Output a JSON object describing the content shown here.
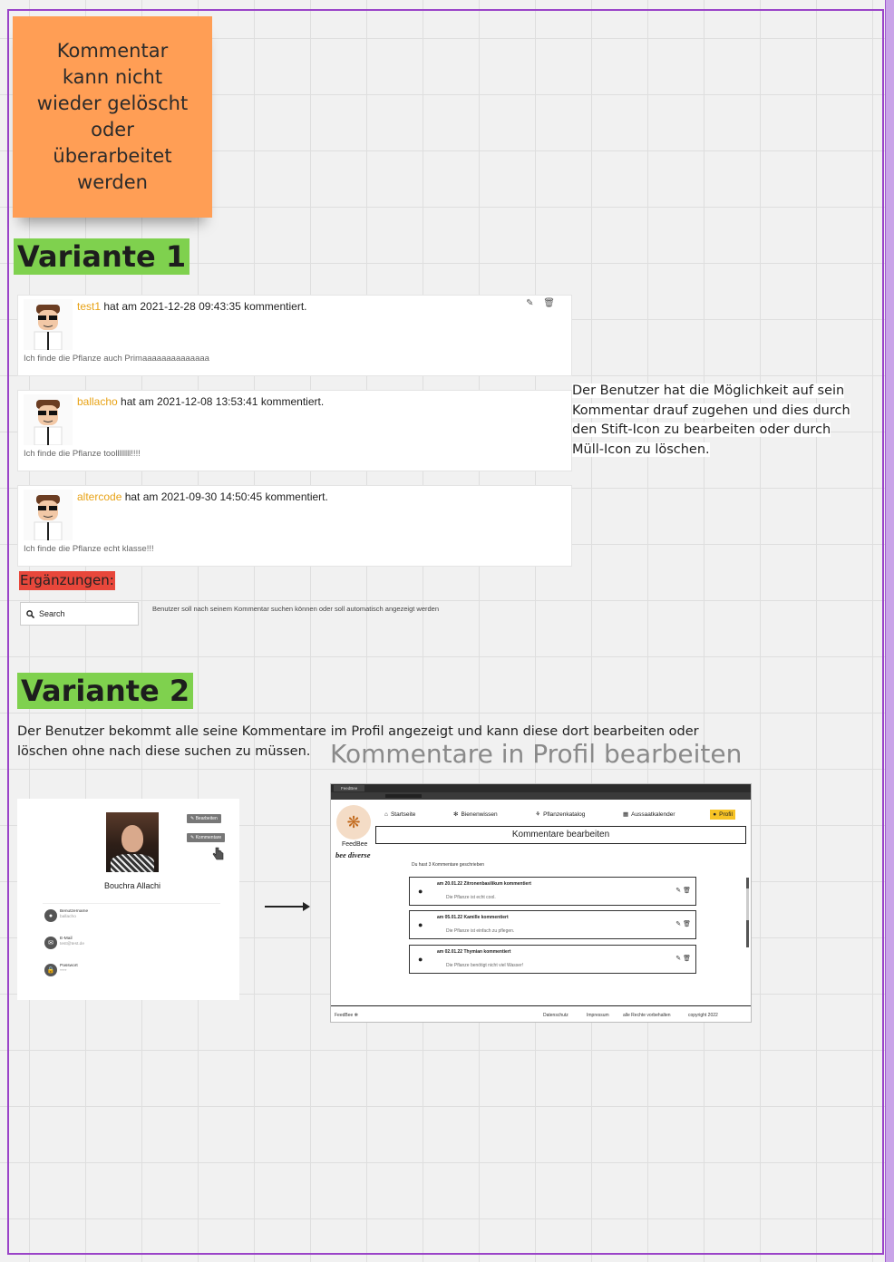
{
  "sticky_note": "Kommentar kann nicht wieder gelöscht oder überarbeitet werden",
  "variant1": {
    "title": "Variante 1",
    "comments": [
      {
        "user": "test1",
        "text": " hat am 2021-12-28 09:43:35 kommentiert.",
        "body": "Ich finde die Pflanze auch Primaaaaaaaaaaaaaa",
        "actions": "✎ 🗑"
      },
      {
        "user": "ballacho",
        "text": " hat am 2021-12-08 13:53:41 kommentiert.",
        "body": "Ich finde die Pflanze toollllllll!!!!"
      },
      {
        "user": "altercode",
        "text": " hat am 2021-09-30 14:50:45 kommentiert.",
        "body": "Ich finde die Pflanze echt klasse!!!"
      }
    ],
    "description": "Der Benutzer hat die Möglichkeit auf sein Kommentar drauf zugehen und dies durch den Stift-Icon zu bearbeiten oder durch Müll-Icon zu löschen.",
    "additions_label": "Ergänzungen:",
    "search_placeholder": "Search",
    "search_note": "Benutzer soll nach seinem Kommentar suchen können oder soll automatisch angezeigt werden"
  },
  "variant2": {
    "title": "Variante 2",
    "description": "Der Benutzer bekommt alle seine Kommentare im Profil angezeigt  und kann diese dort bearbeiten oder löschen ohne nach diese suchen zu müssen.",
    "big_title": "Kommentare in Profil bearbeiten",
    "profile": {
      "name": "Bouchra Allachi",
      "btn_edit": "✎ Bearbeiten",
      "btn_comments": "✎ Kommentare",
      "rows": [
        {
          "label": "Benutzername",
          "value": "ballacho"
        },
        {
          "label": "E-Mail",
          "value": "test@test.de"
        },
        {
          "label": "Passwort",
          "value": "****"
        }
      ]
    },
    "browser": {
      "tab": "FeedBee",
      "brand": "FeedBee",
      "slogan": "bee diverse",
      "nav": [
        "Startseite",
        "Bienenwissen",
        "Pflanzenkatalog",
        "Aussaatkalender",
        "Profil"
      ],
      "edit_title": "Kommentare bearbeiten",
      "count": "Du hast 3 Kommentare geschrieben",
      "comments": [
        {
          "head": "am 20.01.22 Zitronenbasilikum kommentiert",
          "body": "Die Pflanze ist echt cool."
        },
        {
          "head": "am 05.01.22 Kamille kommentiert",
          "body": "Die Pflanze ist einfach zu pflegen."
        },
        {
          "head": "am 02.01.22 Thymian kommentiert",
          "body": "Die Pflanze benötigt nicht viel Wasser!"
        }
      ],
      "footer": {
        "brand": "FeedBee",
        "links": [
          "Datenschutz",
          "Impressum",
          "alle Rechte vorbehalten",
          "copyright 2022"
        ]
      }
    }
  }
}
